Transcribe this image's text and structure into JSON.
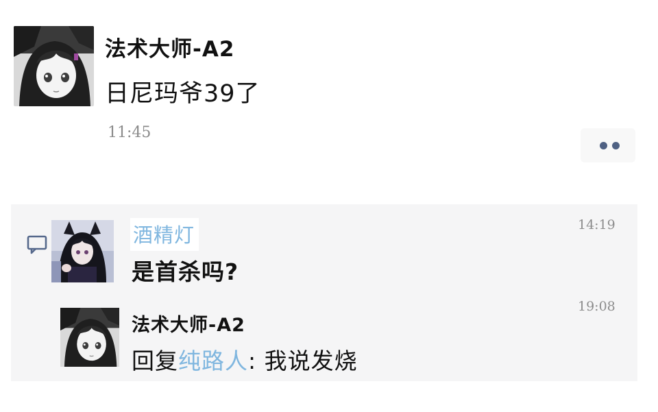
{
  "post": {
    "author": "法术大师-A2",
    "content": "日尼玛爷39了",
    "time": "11:45",
    "more_icon": "more-dots-icon"
  },
  "comments": [
    {
      "author": "酒精灯",
      "text": "是首杀吗?",
      "time": "14:19"
    },
    {
      "author": "法术大师-A2",
      "reply_prefix": "回复",
      "reply_to": "纯路人",
      "reply_separator": ": ",
      "text": "我说发烧",
      "time": "19:08"
    }
  ],
  "colors": {
    "link": "#7fb6df",
    "panel_bg": "#f5f5f6",
    "time_text": "#8a8a8a",
    "dots": "#4f6183"
  },
  "icons": {
    "comment": "comment-bubble-icon",
    "avatar_main": "anime-girl-avatar",
    "avatar_commenter": "anime-catgirl-avatar"
  }
}
